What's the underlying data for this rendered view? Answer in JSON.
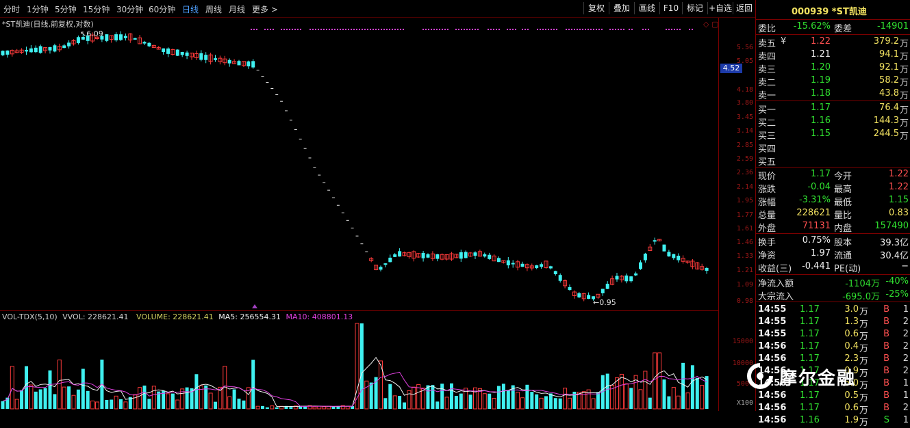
{
  "toolbar": {
    "periods": [
      "分时",
      "1分钟",
      "5分钟",
      "15分钟",
      "30分钟",
      "60分钟",
      "日线",
      "周线",
      "月线",
      "更多 >"
    ],
    "active_period": "日线",
    "buttons": [
      "复权",
      "叠加",
      "画线",
      "F10",
      "标记",
      "+自选",
      "返回"
    ]
  },
  "chart": {
    "title": "*ST凯迪(日线,前复权,对数)",
    "high_label": "6.09",
    "low_label": "0.95",
    "y_ticks": [
      "5.56",
      "5.05",
      "4.18",
      "3.80",
      "3.45",
      "3.14",
      "2.85",
      "2.59",
      "2.36",
      "2.14",
      "1.95",
      "1.77",
      "1.61",
      "1.46",
      "1.33",
      "1.21",
      "1.09",
      "0.98"
    ],
    "current_price_tag": "4.52",
    "up_color": "#ff3b3b",
    "down_color": "#3ff0f0"
  },
  "volume": {
    "indicator": "VOL-TDX(5,10)",
    "vvol": "VVOL: 228621.41",
    "volume": "VOLUME: 228621.41",
    "ma5": "MA5: 256554.31",
    "ma10": "MA10: 408801.13",
    "y_ticks": [
      "15000",
      "10000",
      "5000"
    ],
    "unit": "X100"
  },
  "quote": {
    "code_name": "000939 *ST凯迪",
    "weibi_label": "委比",
    "weibi": "-15.62%",
    "weicha_label": "委差",
    "weicha": "-14901",
    "asks": [
      {
        "label": "卖五",
        "price": "1.22",
        "qty": "379.2",
        "unit": "万",
        "mark": "¥"
      },
      {
        "label": "卖四",
        "price": "1.21",
        "qty": "94.1",
        "unit": "万",
        "mark": ""
      },
      {
        "label": "卖三",
        "price": "1.20",
        "qty": "92.1",
        "unit": "万",
        "mark": ""
      },
      {
        "label": "卖二",
        "price": "1.19",
        "qty": "58.2",
        "unit": "万",
        "mark": ""
      },
      {
        "label": "卖一",
        "price": "1.18",
        "qty": "43.8",
        "unit": "万",
        "mark": ""
      }
    ],
    "bids": [
      {
        "label": "买一",
        "price": "1.17",
        "qty": "76.4",
        "unit": "万"
      },
      {
        "label": "买二",
        "price": "1.16",
        "qty": "144.3",
        "unit": "万"
      },
      {
        "label": "买三",
        "price": "1.15",
        "qty": "244.5",
        "unit": "万"
      },
      {
        "label": "买四",
        "price": "",
        "qty": "",
        "unit": ""
      },
      {
        "label": "买五",
        "price": "",
        "qty": "",
        "unit": ""
      }
    ],
    "stats": [
      {
        "l1": "现价",
        "v1": "1.17",
        "l2": "今开",
        "v2": "1.22"
      },
      {
        "l1": "涨跌",
        "v1": "-0.04",
        "l2": "最高",
        "v2": "1.22"
      },
      {
        "l1": "涨幅",
        "v1": "-3.31%",
        "l2": "最低",
        "v2": "1.15"
      },
      {
        "l1": "总量",
        "v1": "228621",
        "l2": "量比",
        "v2": "0.83"
      },
      {
        "l1": "外盘",
        "v1": "71131",
        "l2": "内盘",
        "v2": "157490"
      }
    ],
    "fund": [
      {
        "l1": "换手",
        "v1": "0.75%",
        "l2": "股本",
        "v2": "39.3亿"
      },
      {
        "l1": "净资",
        "v1": "1.97",
        "l2": "流通",
        "v2": "30.4亿"
      },
      {
        "l1": "收益(三)",
        "v1": "-0.441",
        "l2": "PE(动)",
        "v2": "−"
      }
    ],
    "flows": [
      {
        "label": "净流入额",
        "value": "-1104万",
        "pct": "-40%"
      },
      {
        "label": "大宗流入",
        "value": "-695.0万",
        "pct": "-25%"
      }
    ],
    "ticks": [
      {
        "time": "14:55",
        "price": "1.17",
        "vol": "3.0",
        "unit": "万",
        "side": "B",
        "n": "1"
      },
      {
        "time": "14:55",
        "price": "1.17",
        "vol": "1.3",
        "unit": "万",
        "side": "B",
        "n": "2"
      },
      {
        "time": "14:55",
        "price": "1.17",
        "vol": "0.6",
        "unit": "万",
        "side": "B",
        "n": "2"
      },
      {
        "time": "14:56",
        "price": "1.17",
        "vol": "0.4",
        "unit": "万",
        "side": "B",
        "n": "2"
      },
      {
        "time": "14:56",
        "price": "1.17",
        "vol": "2.3",
        "unit": "万",
        "side": "B",
        "n": "2"
      },
      {
        "time": "14:56",
        "price": "1.17",
        "vol": "0.9",
        "unit": "万",
        "side": "B",
        "n": "2"
      },
      {
        "time": "14:56",
        "price": "1.17",
        "vol": "5.0",
        "unit": "万",
        "side": "B",
        "n": "1"
      },
      {
        "time": "14:56",
        "price": "1.17",
        "vol": "0.5",
        "unit": "万",
        "side": "B",
        "n": "1"
      },
      {
        "time": "14:56",
        "price": "1.17",
        "vol": "0.6",
        "unit": "万",
        "side": "B",
        "n": "2"
      },
      {
        "time": "14:56",
        "price": "1.16",
        "vol": "1.9",
        "unit": "万",
        "side": "S",
        "n": "1"
      }
    ]
  },
  "watermark": "摩尔金融"
}
